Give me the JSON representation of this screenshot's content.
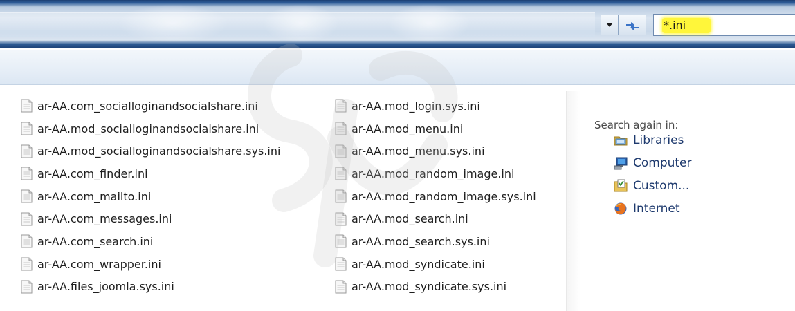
{
  "search": {
    "query": "*.ini"
  },
  "files": {
    "column1": [
      "ar-AA.com_socialloginandsocialshare.ini",
      "ar-AA.mod_socialloginandsocialshare.ini",
      "ar-AA.mod_socialloginandsocialshare.sys.ini",
      "ar-AA.com_finder.ini",
      "ar-AA.com_mailto.ini",
      "ar-AA.com_messages.ini",
      "ar-AA.com_search.ini",
      "ar-AA.com_wrapper.ini",
      "ar-AA.files_joomla.sys.ini"
    ],
    "column2": [
      "ar-AA.mod_login.sys.ini",
      "ar-AA.mod_menu.ini",
      "ar-AA.mod_menu.sys.ini",
      "ar-AA.mod_random_image.ini",
      "ar-AA.mod_random_image.sys.ini",
      "ar-AA.mod_search.ini",
      "ar-AA.mod_search.sys.ini",
      "ar-AA.mod_syndicate.ini",
      "ar-AA.mod_syndicate.sys.ini"
    ]
  },
  "search_again": {
    "heading": "Search again in:",
    "locations": [
      {
        "label": "Libraries",
        "icon": "libraries-icon"
      },
      {
        "label": "Computer",
        "icon": "computer-icon"
      },
      {
        "label": "Custom...",
        "icon": "custom-folder-icon"
      },
      {
        "label": "Internet",
        "icon": "firefox-icon"
      }
    ]
  },
  "colors": {
    "title_bar": "#1b3f73",
    "search_highlight": "#fff63a",
    "location_text": "#1e3a6e"
  }
}
